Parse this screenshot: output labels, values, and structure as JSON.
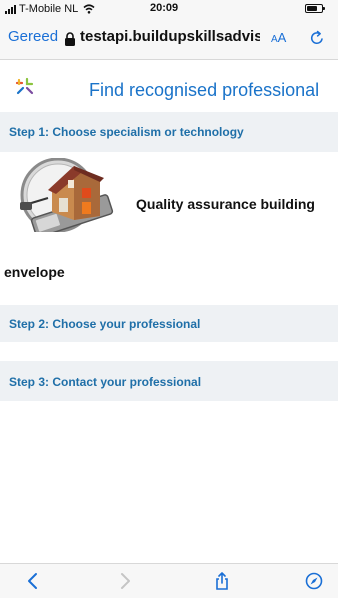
{
  "status_bar": {
    "carrier": "T-Mobile NL",
    "time": "20:09"
  },
  "browser": {
    "done_label": "Gereed",
    "url": "testapi.buildupskillsadvisor",
    "reader_label_small": "A",
    "reader_label_large": "A"
  },
  "page": {
    "title": "Find recognised professional"
  },
  "steps": [
    {
      "label": "Step 1: Choose specialism or technology"
    },
    {
      "label": "Step 2: Choose your professional"
    },
    {
      "label": "Step 3: Contact your professional"
    }
  ],
  "specialism": {
    "label_line1": "Quality assurance building",
    "label_line2": "envelope"
  },
  "colors": {
    "accent": "#1a6fd6",
    "step_text": "#1f6fa8",
    "step_bg": "#eef1f4",
    "title": "#1a73c9"
  },
  "icons": {
    "wifi": "wifi-icon",
    "battery": "battery-icon",
    "lock": "lock-icon",
    "reload": "reload-icon",
    "back": "chevron-left-icon",
    "forward": "chevron-right-icon",
    "share": "share-icon",
    "safari": "compass-icon"
  }
}
